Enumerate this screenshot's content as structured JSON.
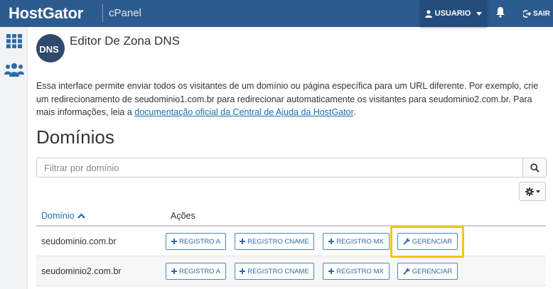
{
  "header": {
    "brand": "HostGator",
    "product": "cPanel",
    "user_label": "USUARIO",
    "logout_label": "SAIR",
    "icons": [
      "user-icon",
      "bell-icon",
      "logout-icon"
    ],
    "color": "#2d5b8f"
  },
  "sidebar": {
    "items": [
      {
        "icon": "apps-grid-icon"
      },
      {
        "icon": "users-icon"
      }
    ]
  },
  "page": {
    "logo_text": "DNS",
    "title": "Editor De Zona DNS",
    "description_text": "Essa interface permite enviar todos os visitantes de um domínio ou página específica para um URL diferente. Por exemplo, crie um redirecionamento de seudominio1.com.br para redirecionar automaticamente os visitantes para seudominio2.com.br. Para mais informações, leia a ",
    "description_link": "documentação oficial da Central de Ajuda da HostGator",
    "description_end": "."
  },
  "domains": {
    "section_title": "Domínios",
    "search_placeholder": "Filtrar por domínio",
    "columns": {
      "domain": "Domínio",
      "actions": "Ações"
    },
    "sort": "ascending",
    "rows": [
      {
        "domain": "seudominio.com.br"
      },
      {
        "domain": "seudominio2.com.br"
      }
    ],
    "action_labels": {
      "a": "REGISTRO A",
      "cname": "REGISTRO CNAME",
      "mx": "REGISTRO MX",
      "manage": "GERENCIAR"
    },
    "highlight_color": "#f2c418"
  }
}
